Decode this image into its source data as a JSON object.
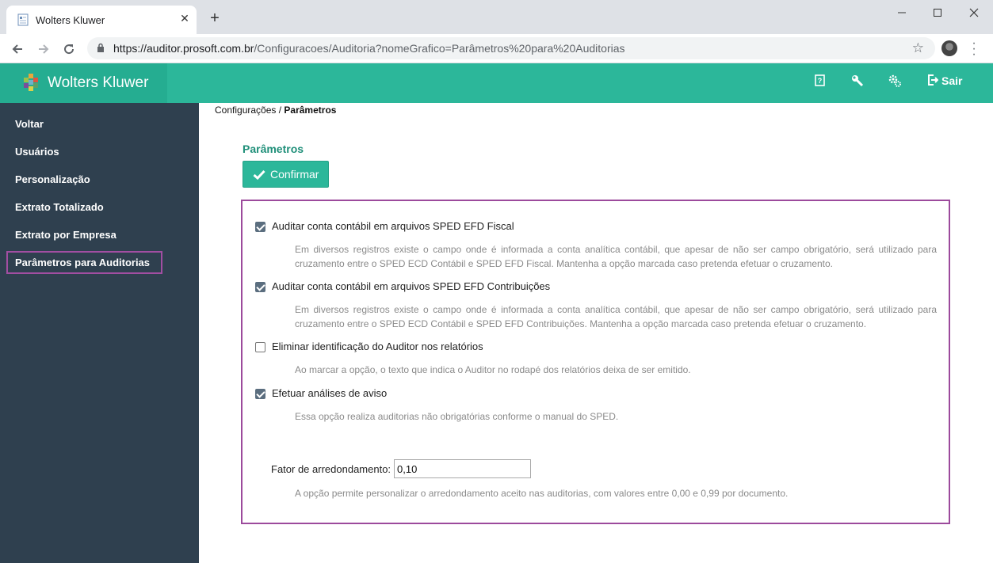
{
  "browser": {
    "tab_title": "Wolters Kluwer",
    "url_host": "https://auditor.prosoft.com.br",
    "url_path": "/Configuracoes/Auditoria?nomeGrafico=Parâmetros%20para%20Auditorias"
  },
  "header": {
    "brand": "Wolters Kluwer",
    "logout_label": "Sair"
  },
  "sidebar": {
    "items": [
      {
        "label": "Voltar"
      },
      {
        "label": "Usuários"
      },
      {
        "label": "Personalização"
      },
      {
        "label": "Extrato Totalizado"
      },
      {
        "label": "Extrato por Empresa"
      },
      {
        "label": "Parâmetros para Auditorias"
      }
    ],
    "active_index": 5
  },
  "breadcrumb": {
    "parent": "Configurações",
    "separator": " / ",
    "current": "Parâmetros"
  },
  "main": {
    "title": "Parâmetros",
    "confirm_label": "Confirmar"
  },
  "options": [
    {
      "label": "Auditar conta contábil em arquivos SPED EFD Fiscal",
      "checked": true,
      "description": "Em diversos registros existe o campo onde é informada a conta analítica contábil, que apesar de não ser campo obrigatório, será utilizado para cruzamento entre o SPED ECD Contábil e SPED EFD Fiscal. Mantenha a opção marcada caso pretenda efetuar o cruzamento."
    },
    {
      "label": "Auditar conta contábil em arquivos SPED EFD Contribuições",
      "checked": true,
      "description": "Em diversos registros existe o campo onde é informada a conta analítica contábil, que apesar de não ser campo obrigatório, será utilizado para cruzamento entre o SPED ECD Contábil e SPED EFD Contribuições. Mantenha a opção marcada caso pretenda efetuar o cruzamento."
    },
    {
      "label": "Eliminar identificação do Auditor nos relatórios",
      "checked": false,
      "description": "Ao marcar a opção, o texto que indica o Auditor no rodapé dos relatórios deixa de ser emitido."
    },
    {
      "label": "Efetuar análises de aviso",
      "checked": true,
      "description": "Essa opção realiza auditorias não obrigatórias conforme o manual do SPED."
    }
  ],
  "rounding": {
    "label": "Fator de arredondamento:",
    "value": "0,10",
    "description": "A opção permite personalizar o arredondamento aceito nas auditorias, com valores entre 0,00 e 0,99 por documento."
  },
  "colors": {
    "accent": "#2cb79a",
    "sidebar_bg": "#2f404f",
    "highlight_border": "#9c4a9c"
  }
}
